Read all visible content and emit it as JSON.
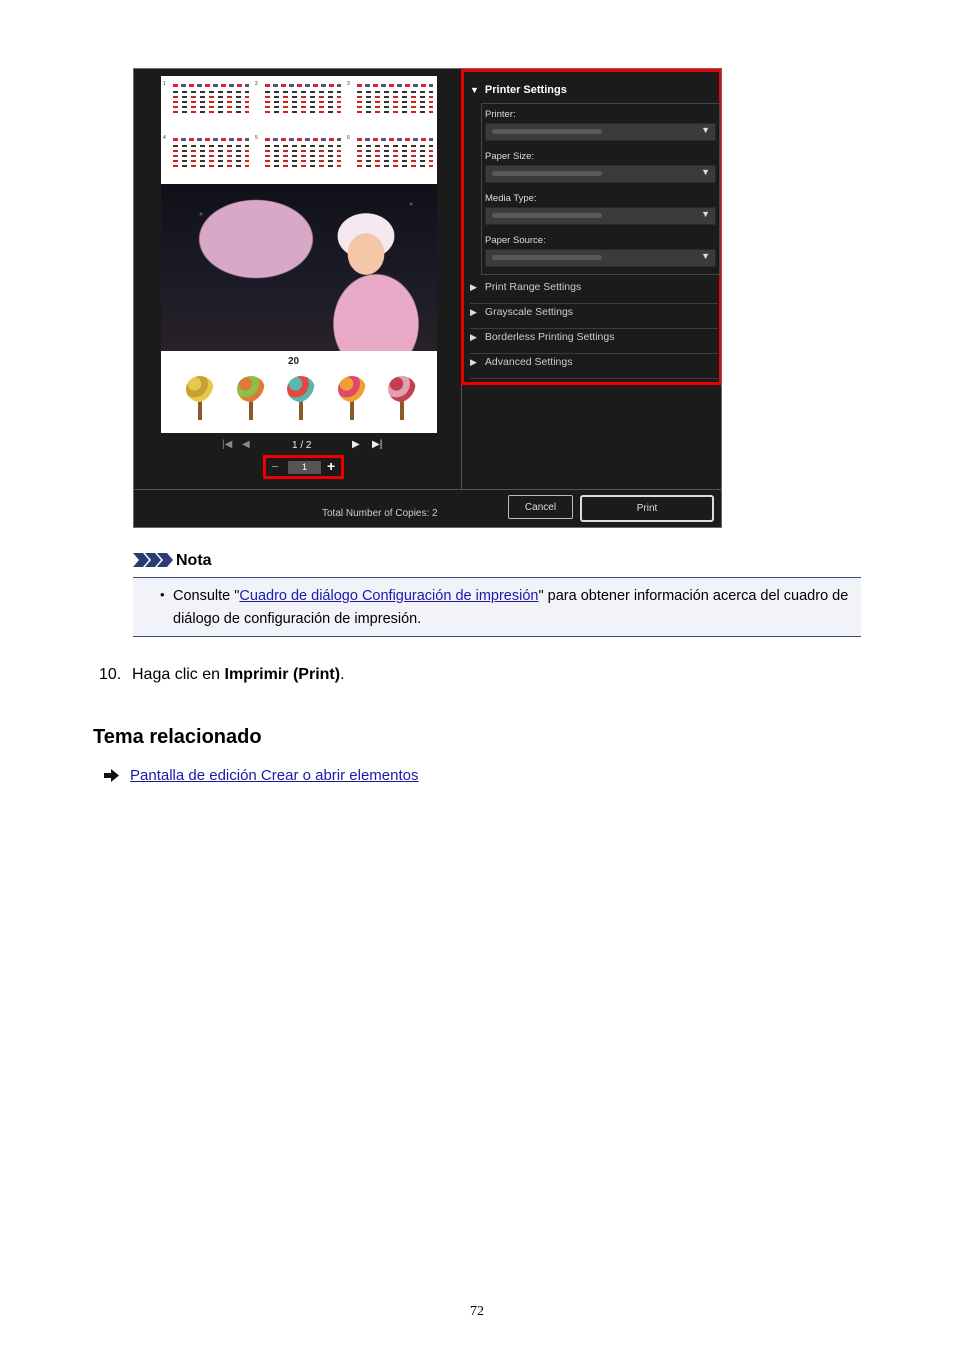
{
  "dialog": {
    "pager": {
      "page_indicator": "1 / 2"
    },
    "copies": {
      "minus": "−",
      "value": "1",
      "plus": "+"
    },
    "preview": {
      "year_label": "20"
    },
    "printer_settings": {
      "header": "Printer Settings",
      "fields": [
        {
          "label": "Printer:"
        },
        {
          "label": "Paper Size:"
        },
        {
          "label": "Media Type:"
        },
        {
          "label": "Paper Source:"
        }
      ]
    },
    "sections": [
      "Print Range Settings",
      "Grayscale Settings",
      "Borderless Printing Settings",
      "Advanced Settings"
    ],
    "total_copies": "Total Number of Copies:  2",
    "cancel_label": "Cancel",
    "print_label": "Print",
    "highlight_color": "#e00000"
  },
  "note": {
    "title": "Nota",
    "text_before": "Consulte \"",
    "link": "Cuadro de diálogo Configuración de impresión",
    "text_after": "\" para obtener información acerca del cuadro de diálogo de configuración de impresión."
  },
  "step": {
    "number": "10.",
    "text_before": "Haga clic en ",
    "bold": "Imprimir (Print)",
    "text_after": "."
  },
  "related": {
    "title": "Tema relacionado",
    "link": "Pantalla de edición Crear o abrir elementos"
  },
  "page_number": "72",
  "colors": {
    "link": "#1a1aa8",
    "note_border": "#3a4a7a",
    "note_bg": "#f1f3f9"
  }
}
